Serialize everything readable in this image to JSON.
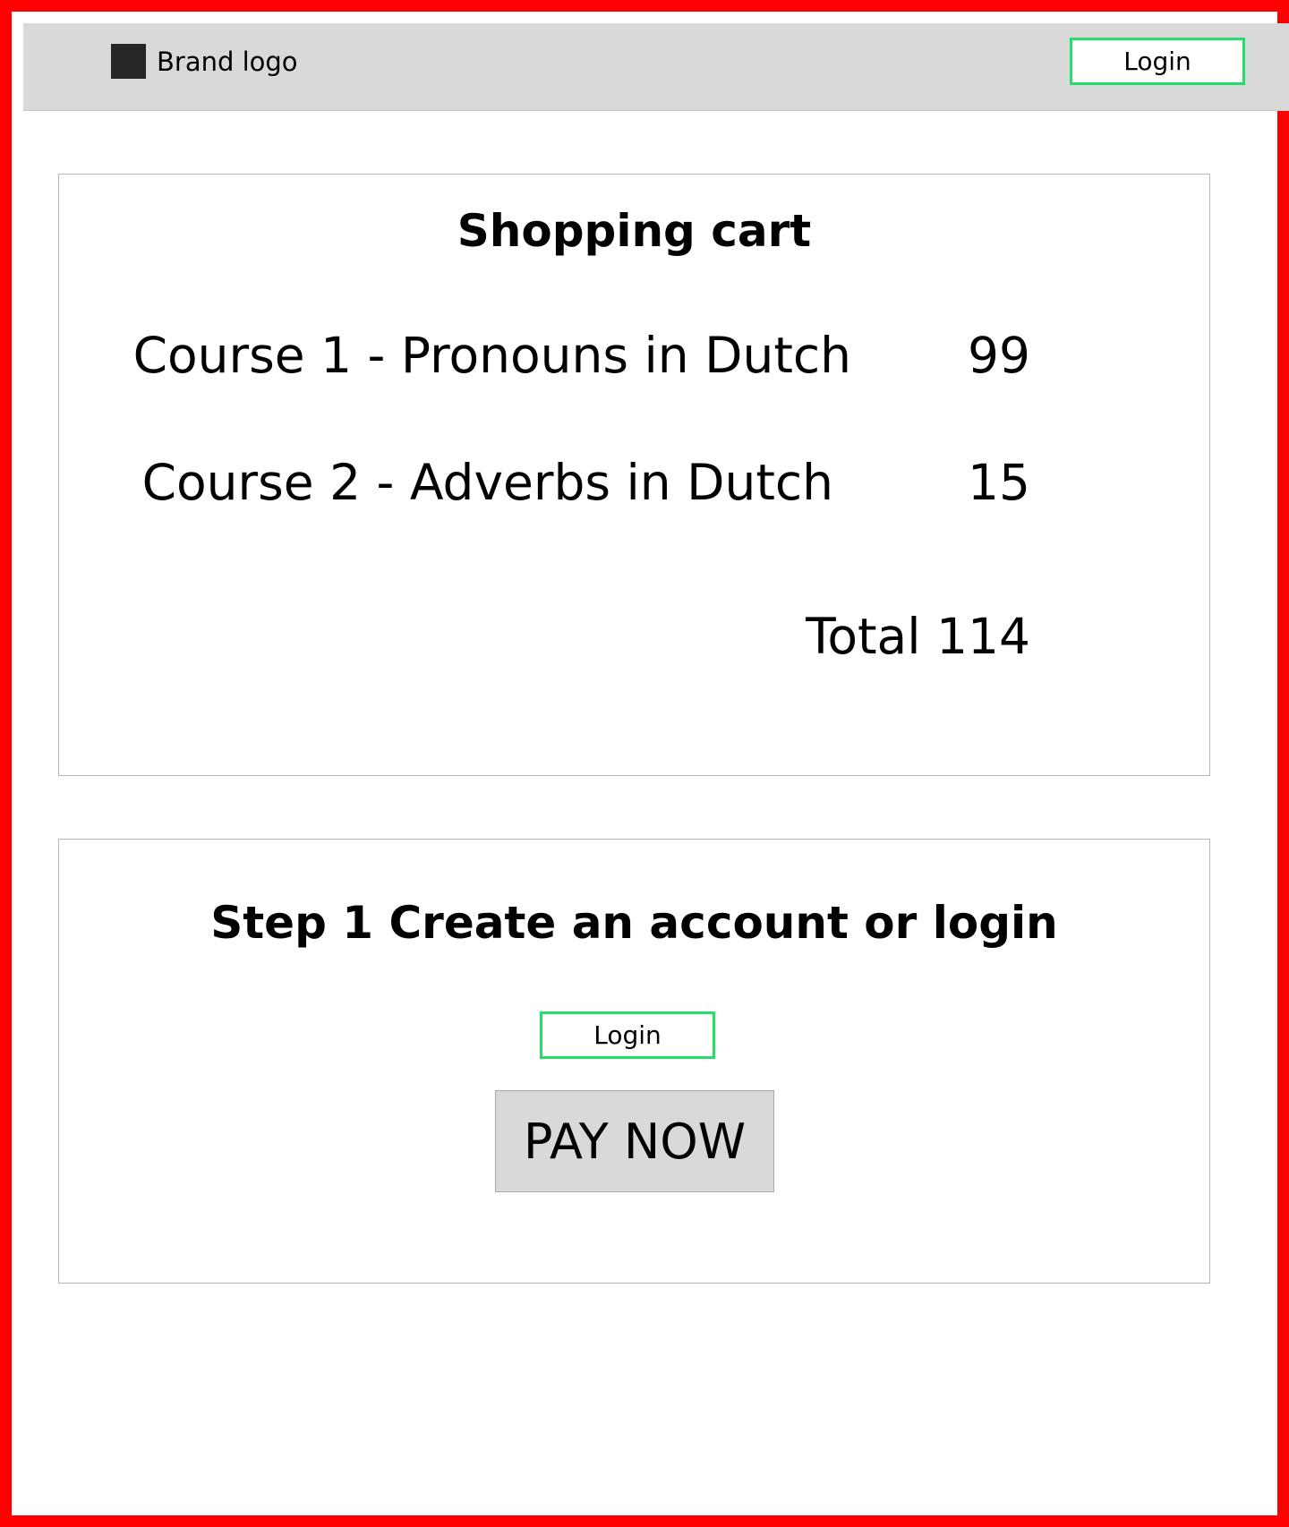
{
  "header": {
    "brand_label": "Brand logo",
    "login_label": "Login"
  },
  "cart": {
    "title": "Shopping cart",
    "items": [
      {
        "name": "Course 1 - Pronouns in Dutch",
        "price": "99"
      },
      {
        "name": "Course 2 - Adverbs in Dutch",
        "price": "15"
      }
    ],
    "total": "Total 114"
  },
  "step": {
    "title": "Step 1 Create an account or login",
    "login_label": "Login",
    "pay_label": "PAY NOW"
  },
  "colors": {
    "frame_border": "#ff0000",
    "header_bg": "#d9d9d9",
    "login_border": "#22e067",
    "pay_button_bg": "#d9d9d9"
  }
}
